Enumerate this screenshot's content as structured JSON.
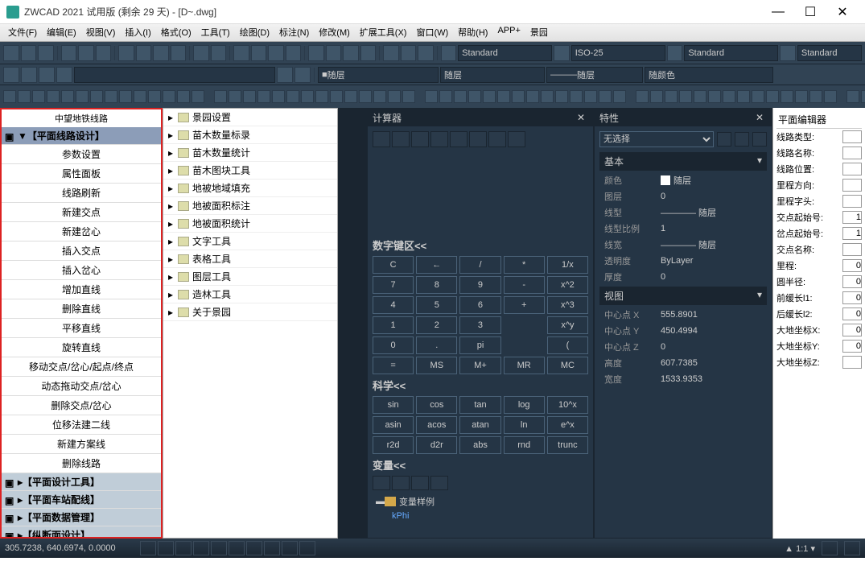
{
  "window": {
    "title": "ZWCAD 2021 试用版 (剩余 29 天) - [D~.dwg]"
  },
  "menu": [
    "文件(F)",
    "编辑(E)",
    "视图(V)",
    "插入(I)",
    "格式(O)",
    "工具(T)",
    "绘图(D)",
    "标注(N)",
    "修改(M)",
    "扩展工具(X)",
    "窗口(W)",
    "帮助(H)",
    "APP+",
    "景园"
  ],
  "toolbar2": {
    "std1": "Standard",
    "iso": "ISO-25",
    "std2": "Standard",
    "std3": "Standard",
    "layer": "随层",
    "ltype": "随层",
    "lw": "随层",
    "color": "随颜色"
  },
  "left": {
    "title": "中望地铁线路",
    "cats": [
      "【平面线路设计】",
      "【平面设计工具】",
      "【平面车站配线】",
      "【平面数据管理】",
      "【纵断面设计】"
    ],
    "items": [
      "参数设置",
      "属性面板",
      "线路刷新",
      "新建交点",
      "新建岔心",
      "插入交点",
      "插入岔心",
      "增加直线",
      "删除直线",
      "平移直线",
      "旋转直线",
      "移动交点/岔心/起点/终点",
      "动态拖动交点/岔心",
      "删除交点/岔心",
      "位移法建二线",
      "新建方案线",
      "删除线路"
    ]
  },
  "tree": [
    "景园设置",
    "苗木数量标录",
    "苗木数量统计",
    "苗木图块工具",
    "地被地域填充",
    "地被面积标注",
    "地被面积统计",
    "文字工具",
    "表格工具",
    "图层工具",
    "造林工具",
    "关于景园"
  ],
  "calc": {
    "title": "计算器",
    "numpad_hdr": "数字键区<<",
    "sci_hdr": "科学<<",
    "var_hdr": "变量<<",
    "keys": [
      [
        "C",
        "←",
        "/",
        "*",
        "1/x"
      ],
      [
        "7",
        "8",
        "9",
        "-",
        "x^2"
      ],
      [
        "4",
        "5",
        "6",
        "+",
        "x^3"
      ],
      [
        "1",
        "2",
        "3",
        "",
        "x^y"
      ],
      [
        "0",
        ".",
        "pi",
        "",
        "("
      ],
      [
        "=",
        "MS",
        "M+",
        "MR",
        "MC"
      ]
    ],
    "sci": [
      [
        "sin",
        "cos",
        "tan",
        "log",
        "10^x"
      ],
      [
        "asin",
        "acos",
        "atan",
        "ln",
        "e^x"
      ],
      [
        "r2d",
        "d2r",
        "abs",
        "rnd",
        "trunc"
      ]
    ],
    "var_sample": "变量样例",
    "var_phi": "Phi"
  },
  "props": {
    "title": "特性",
    "sel": "无选择",
    "g1": "基本",
    "g2": "视图",
    "rows1": [
      {
        "l": "颜色",
        "v": "随层",
        "sw": true
      },
      {
        "l": "图层",
        "v": "0"
      },
      {
        "l": "线型",
        "v": "———— 随层"
      },
      {
        "l": "线型比例",
        "v": "1"
      },
      {
        "l": "线宽",
        "v": "———— 随层"
      },
      {
        "l": "透明度",
        "v": "ByLayer"
      },
      {
        "l": "厚度",
        "v": "0"
      }
    ],
    "rows2": [
      {
        "l": "中心点 X",
        "v": "555.8901"
      },
      {
        "l": "中心点 Y",
        "v": "450.4994"
      },
      {
        "l": "中心点 Z",
        "v": "0"
      },
      {
        "l": "高度",
        "v": "607.7385"
      },
      {
        "l": "宽度",
        "v": "1533.9353"
      }
    ]
  },
  "right": {
    "title": "平面编辑器",
    "rows": [
      {
        "l": "线路类型:",
        "v": ""
      },
      {
        "l": "线路名称:",
        "v": ""
      },
      {
        "l": "线路位置:",
        "v": ""
      },
      {
        "l": "里程方向:",
        "v": ""
      },
      {
        "l": "里程字头:",
        "v": ""
      },
      {
        "l": "交点起始号:",
        "v": "1"
      },
      {
        "l": "岔点起始号:",
        "v": "1"
      },
      {
        "l": "交点名称:",
        "v": ""
      },
      {
        "l": "里程:",
        "v": "0"
      },
      {
        "l": "圆半径:",
        "v": "0"
      },
      {
        "l": "前缓长l1:",
        "v": "0"
      },
      {
        "l": "后缓长l2:",
        "v": "0"
      },
      {
        "l": "大地坐标X:",
        "v": "0"
      },
      {
        "l": "大地坐标Y:",
        "v": "0"
      },
      {
        "l": "大地坐标Z:",
        "v": ""
      }
    ]
  },
  "status": {
    "coords": "305.7238, 640.6974, 0.0000",
    "scale": "1:1"
  }
}
